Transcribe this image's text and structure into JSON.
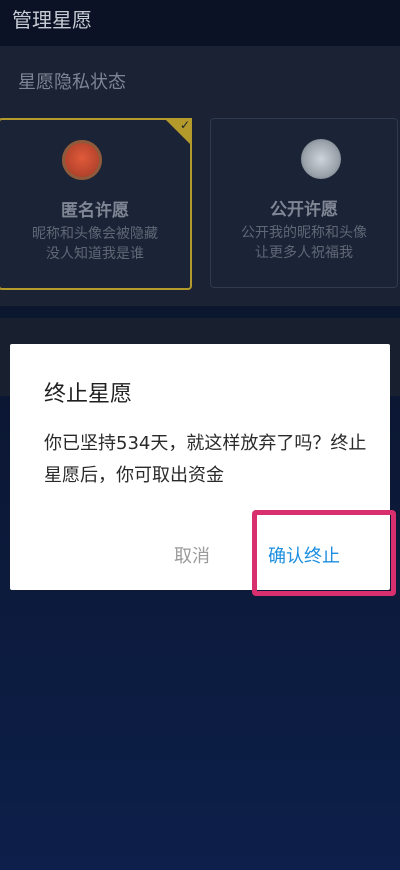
{
  "header": {
    "title": "管理星愿"
  },
  "privacy": {
    "section_title": "星愿隐私状态",
    "options": [
      {
        "title": "匿名许愿",
        "desc_line1": "昵称和头像会被隐藏",
        "desc_line2": "没人知道我是谁",
        "selected": true
      },
      {
        "title": "公开许愿",
        "desc_line1": "公开我的昵称和头像",
        "desc_line2": "让更多人祝福我",
        "selected": false
      }
    ]
  },
  "dialog": {
    "title": "终止星愿",
    "message": "你已坚持534天，就这样放弃了吗？终止星愿后，你可取出资金",
    "cancel_label": "取消",
    "confirm_label": "确认终止"
  },
  "colors": {
    "background": "#0b1630",
    "accent_gold": "#b49a2a",
    "confirm_blue": "#1b8ee0",
    "highlight_pink": "#d8306e"
  },
  "icons": {
    "anonymous": "anonymous-avatar-icon",
    "public": "public-avatar-icon",
    "selected": "checkmark-icon"
  }
}
